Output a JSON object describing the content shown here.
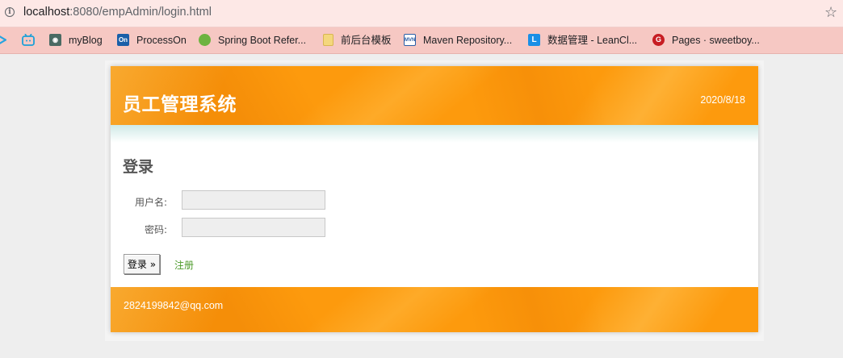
{
  "browser": {
    "url_host": "localhost",
    "url_rest": ":8080/empAdmin/login.html",
    "bookmarks": [
      {
        "label": "",
        "icon": "play-icon",
        "color": "#26a4e0"
      },
      {
        "label": "",
        "icon": "bilibili-tv-icon",
        "color": "#1ba0d8"
      },
      {
        "label": "myBlog",
        "icon": "game-controller-icon",
        "color": "#4a6a63"
      },
      {
        "label": "ProcessOn",
        "icon": "on-logo-icon",
        "color": "#1a5fa8"
      },
      {
        "label": "Spring Boot Refer...",
        "icon": "spring-leaf-icon",
        "color": "#6db33f"
      },
      {
        "label": "前后台模板",
        "icon": "folder-icon",
        "color": "#f4d77c"
      },
      {
        "label": "Maven Repository...",
        "icon": "mvn-logo-icon",
        "color": "#2b5ea6"
      },
      {
        "label": "数据管理 - LeanCl...",
        "icon": "leancloud-icon",
        "color": "#1a8fe6"
      },
      {
        "label": "Pages · sweetboy...",
        "icon": "gitee-icon",
        "color": "#c71d23"
      }
    ]
  },
  "header": {
    "title": "员工管理系统",
    "date": "2020/8/18"
  },
  "login": {
    "heading": "登录",
    "username_label": "用户名:",
    "username_value": "",
    "password_label": "密码:",
    "password_value": "",
    "submit_label": "登录 »",
    "register_label": "注册"
  },
  "footer": {
    "email": "2824199842@qq.com"
  }
}
